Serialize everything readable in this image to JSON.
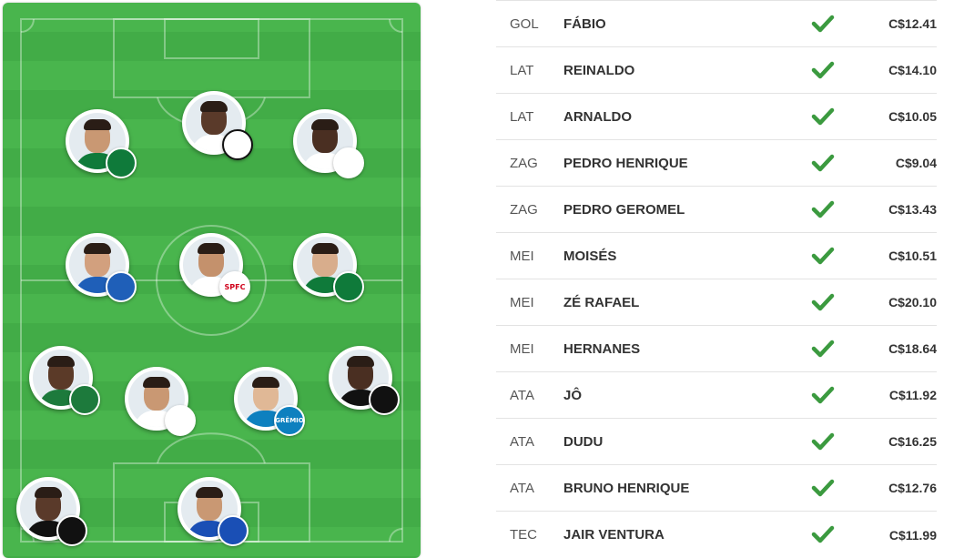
{
  "field": {
    "players": [
      {
        "badge_icon": "palmeiras-badge-icon",
        "badge_text": "",
        "skin": "#c99873",
        "shirt": "#0f7a3a"
      },
      {
        "badge_icon": "santos-badge-icon",
        "badge_text": "",
        "skin": "#5a3a2a",
        "shirt": "#ffffff"
      },
      {
        "badge_icon": "corinthians-badge-icon",
        "badge_text": "",
        "skin": "#4a2f22",
        "shirt": "#ffffff"
      },
      {
        "badge_icon": "bahia-badge-icon",
        "badge_text": "",
        "skin": "#d2a07e",
        "shirt": "#1f5fb8"
      },
      {
        "badge_icon": "sao-paulo-badge-icon",
        "badge_text": "SPFC",
        "skin": "#c4916c",
        "shirt": "#ffffff"
      },
      {
        "badge_icon": "palmeiras-badge-icon",
        "badge_text": "",
        "skin": "#d8ad8c",
        "shirt": "#0f7a3a"
      },
      {
        "badge_icon": "chapecoense-badge-icon",
        "badge_text": "",
        "skin": "#5b3a28",
        "shirt": "#1d7a3c"
      },
      {
        "badge_icon": "corinthians-badge-icon",
        "badge_text": "",
        "skin": "#c99873",
        "shirt": "#ffffff"
      },
      {
        "badge_icon": "gremio-badge-icon",
        "badge_text": "GRÊMIO",
        "skin": "#e0b896",
        "shirt": "#0d80bf"
      },
      {
        "badge_icon": "botafogo-badge-icon",
        "badge_text": "",
        "skin": "#4a2f22",
        "shirt": "#111111"
      },
      {
        "badge_icon": "botafogo-badge-icon",
        "badge_text": "",
        "skin": "#5a3a2a",
        "shirt": "#111111"
      },
      {
        "badge_icon": "cruzeiro-badge-icon",
        "badge_text": "",
        "skin": "#c99873",
        "shirt": "#1a4fb5"
      }
    ]
  },
  "roster": [
    {
      "position": "GOL",
      "name": "FÁBIO",
      "status_icon": "check-icon",
      "price": "C$12.41"
    },
    {
      "position": "LAT",
      "name": "REINALDO",
      "status_icon": "check-icon",
      "price": "C$14.10"
    },
    {
      "position": "LAT",
      "name": "ARNALDO",
      "status_icon": "check-icon",
      "price": "C$10.05"
    },
    {
      "position": "ZAG",
      "name": "PEDRO HENRIQUE",
      "status_icon": "check-icon",
      "price": "C$9.04"
    },
    {
      "position": "ZAG",
      "name": "PEDRO GEROMEL",
      "status_icon": "check-icon",
      "price": "C$13.43"
    },
    {
      "position": "MEI",
      "name": "MOISÉS",
      "status_icon": "check-icon",
      "price": "C$10.51"
    },
    {
      "position": "MEI",
      "name": "ZÉ RAFAEL",
      "status_icon": "check-icon",
      "price": "C$20.10"
    },
    {
      "position": "MEI",
      "name": "HERNANES",
      "status_icon": "check-icon",
      "price": "C$18.64"
    },
    {
      "position": "ATA",
      "name": "JÔ",
      "status_icon": "check-icon",
      "price": "C$11.92"
    },
    {
      "position": "ATA",
      "name": "DUDU",
      "status_icon": "check-icon",
      "price": "C$16.25"
    },
    {
      "position": "ATA",
      "name": "BRUNO HENRIQUE",
      "status_icon": "check-icon",
      "price": "C$12.76"
    },
    {
      "position": "TEC",
      "name": "JAIR VENTURA",
      "status_icon": "check-icon",
      "price": "C$11.99"
    }
  ],
  "colors": {
    "field_green": "#49b54d",
    "check_green": "#3b9a3f",
    "text_dark": "#333333",
    "text_muted": "#555555"
  }
}
